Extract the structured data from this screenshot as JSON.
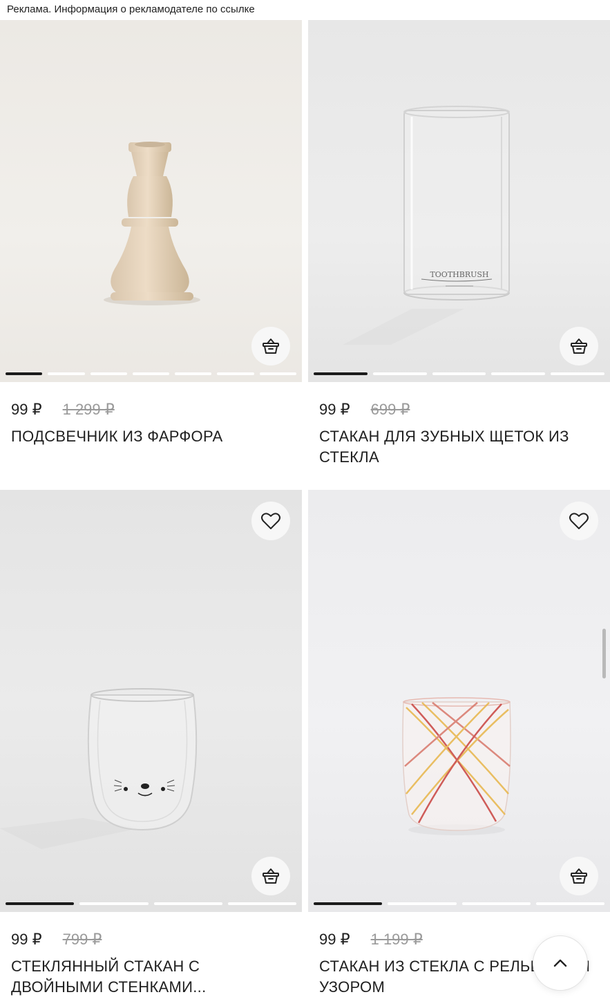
{
  "ad_notice": "Реклама. Информация о рекламодателе по ссылке",
  "products": [
    {
      "price": "99 ₽",
      "old_price": "1 299 ₽",
      "title": "ПОДСВЕЧНИК ИЗ ФАРФОРА",
      "image": "candlestick-image",
      "action_icon": "basket-icon",
      "gallery_total": 7,
      "gallery_active": 1
    },
    {
      "price": "99 ₽",
      "old_price": "699 ₽",
      "title": "СТАКАН ДЛЯ ЗУБНЫХ ЩЕТОК ИЗ СТЕКЛА",
      "image": "toothbrush-glass-image",
      "image_text": "TOOTHBRUSH",
      "action_icon": "basket-icon",
      "gallery_total": 5,
      "gallery_active": 1
    },
    {
      "price": "99 ₽",
      "old_price": "799 ₽",
      "title": "СТЕКЛЯННЫЙ СТАКАН С ДВОЙНЫМИ СТЕНКАМИ...",
      "image": "double-wall-glass-image",
      "action_icon": "basket-icon",
      "favorite_icon": "heart-icon",
      "gallery_total": 4,
      "gallery_active": 1
    },
    {
      "price": "99 ₽",
      "old_price": "1 199 ₽",
      "title": "СТАКАН ИЗ СТЕКЛА С РЕЛЬЕФНЫМ УЗОРОМ",
      "image": "striped-glass-image",
      "action_icon": "basket-icon",
      "favorite_icon": "heart-icon",
      "gallery_total": 4,
      "gallery_active": 1
    }
  ],
  "scroll_to_top_icon": "chevron-up-icon",
  "colors": {
    "text": "#1f1f1f",
    "old_price": "#9a9a9a",
    "dot_active": "#1b1b1b",
    "dot_inactive": "#ffffff"
  }
}
